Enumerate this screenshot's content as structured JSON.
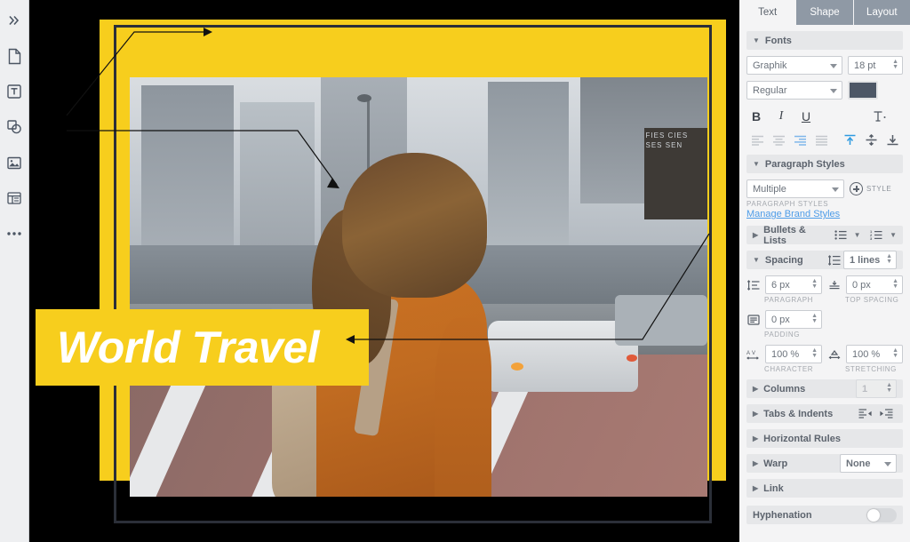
{
  "left_toolbar": {
    "items": [
      {
        "name": "expand-panel",
        "icon": "double-chevron-right-icon"
      },
      {
        "name": "page-tool",
        "icon": "document-page-icon"
      },
      {
        "name": "text-tool",
        "icon": "text-box-icon"
      },
      {
        "name": "shapes-tool",
        "icon": "shapes-icon"
      },
      {
        "name": "image-tool",
        "icon": "image-icon"
      },
      {
        "name": "table-tool",
        "icon": "table-grid-icon"
      },
      {
        "name": "more-tools",
        "icon": "ellipsis-icon"
      }
    ]
  },
  "canvas": {
    "banner_text": "World Travel",
    "yellow_color": "#f7ce1d",
    "photo_sign_text": "FIES\nCIES\nSES\nSEN"
  },
  "panel": {
    "tabs": [
      {
        "label": "Text",
        "active": true
      },
      {
        "label": "Shape",
        "active": false
      },
      {
        "label": "Layout",
        "active": false
      }
    ],
    "fonts": {
      "title": "Fonts",
      "family": "Graphik",
      "size": "18 pt",
      "style": "Regular",
      "color": "#4d5766"
    },
    "format": {
      "bold": "B",
      "italic": "I",
      "underline": "U",
      "text_options_icon": "text-options-icon",
      "align_left_icon": "align-left-icon",
      "align_center_icon": "align-center-icon",
      "align_right_icon": "align-right-icon",
      "align_justify_icon": "align-justify-icon",
      "valign_top_icon": "vertical-align-top-icon",
      "valign_middle_icon": "vertical-align-middle-icon",
      "valign_bottom_icon": "vertical-align-bottom-icon"
    },
    "paragraph_styles": {
      "title": "Paragraph Styles",
      "selected": "Multiple",
      "style_button": "STYLE",
      "caption": "PARAGRAPH STYLES",
      "manage_link": "Manage Brand Styles"
    },
    "bullets": {
      "title": "Bullets & Lists",
      "bullet_list_icon": "bullet-list-icon",
      "numbered_list_icon": "numbered-list-icon"
    },
    "spacing": {
      "title": "Spacing",
      "line_spacing_value": "1 lines",
      "paragraph_value": "6 px",
      "paragraph_label": "PARAGRAPH",
      "top_spacing_value": "0 px",
      "top_spacing_label": "TOP SPACING",
      "padding_value": "0 px",
      "padding_label": "PADDING",
      "character_value": "100 %",
      "character_label": "CHARACTER",
      "stretching_value": "100 %",
      "stretching_label": "STRETCHING"
    },
    "columns": {
      "title": "Columns",
      "value": "1"
    },
    "tabs_indents": {
      "title": "Tabs & Indents"
    },
    "horizontal_rules": {
      "title": "Horizontal Rules"
    },
    "warp": {
      "title": "Warp",
      "value": "None"
    },
    "link": {
      "title": "Link"
    },
    "hyphenation": {
      "title": "Hyphenation",
      "enabled": false
    }
  }
}
